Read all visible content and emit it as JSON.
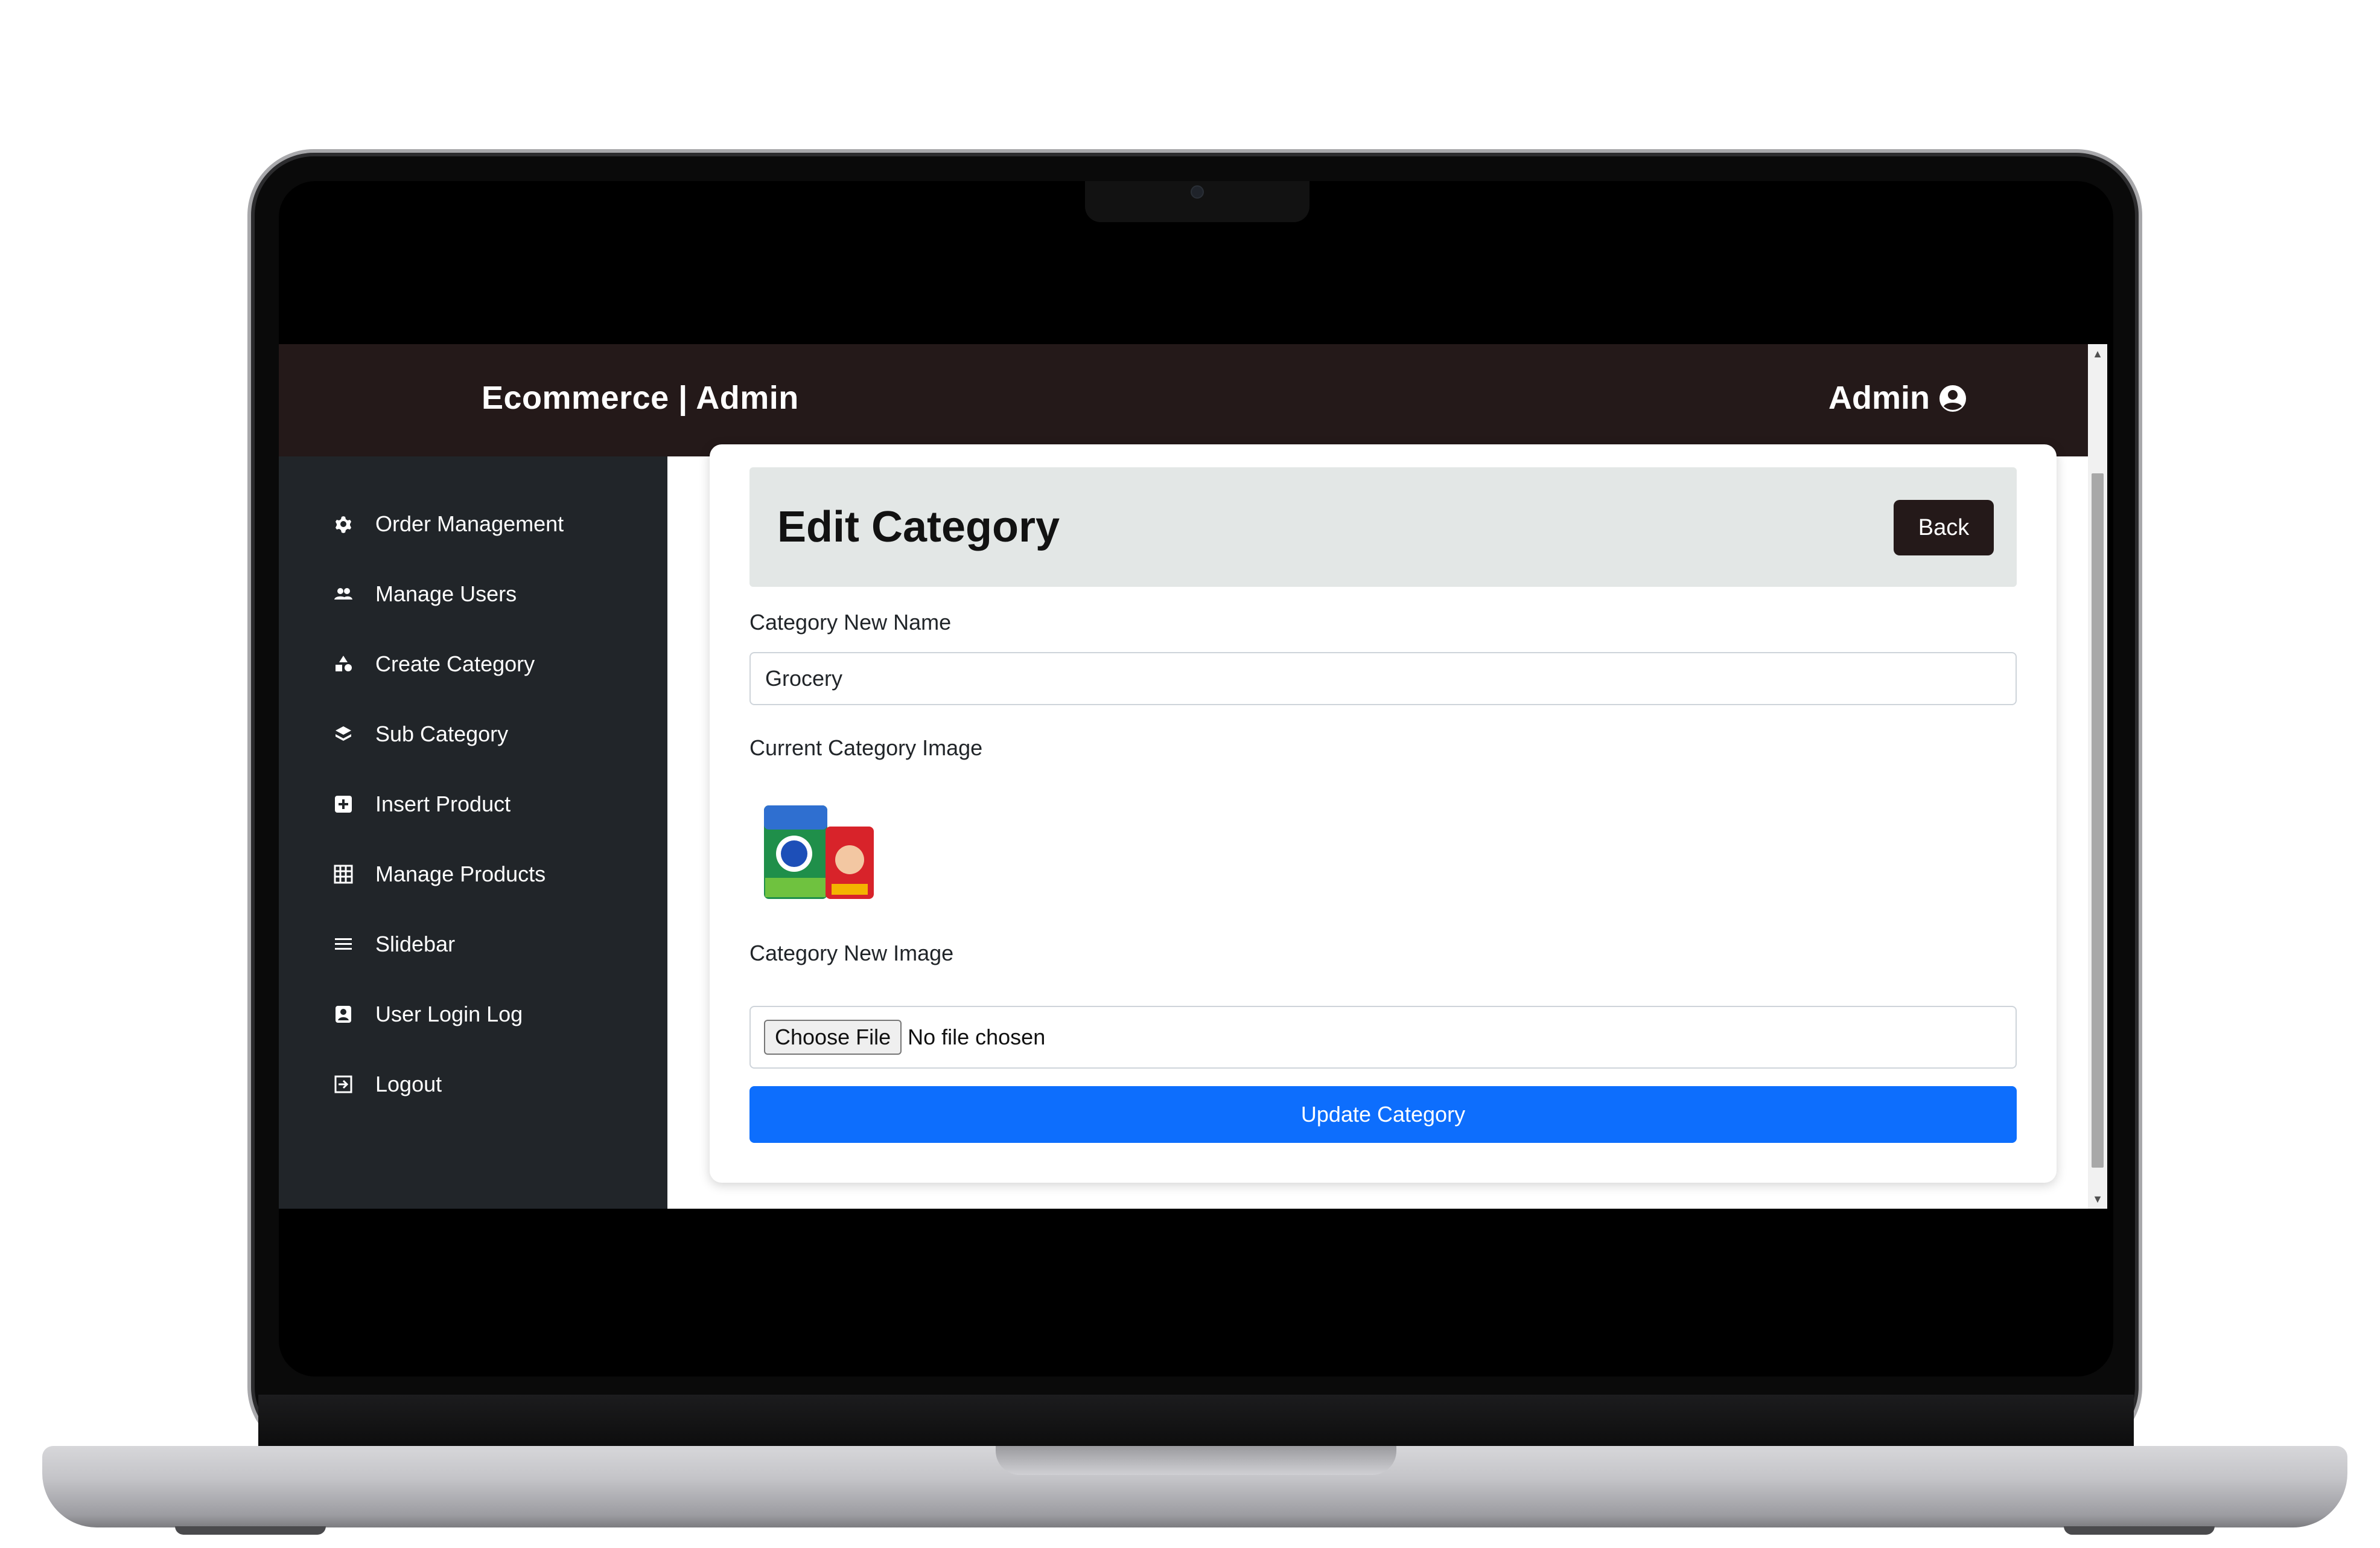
{
  "header": {
    "brand": "Ecommerce | Admin",
    "user_label": "Admin",
    "user_icon": "user-circle-icon"
  },
  "sidebar": {
    "items": [
      {
        "label": "Order Management",
        "icon": "gear-icon"
      },
      {
        "label": "Manage Users",
        "icon": "users-icon"
      },
      {
        "label": "Create Category",
        "icon": "shapes-icon"
      },
      {
        "label": "Sub Category",
        "icon": "layers-icon"
      },
      {
        "label": "Insert Product",
        "icon": "plus-square-icon"
      },
      {
        "label": "Manage Products",
        "icon": "table-icon"
      },
      {
        "label": "Slidebar",
        "icon": "bars-icon"
      },
      {
        "label": "User Login Log",
        "icon": "id-badge-icon"
      },
      {
        "label": "Logout",
        "icon": "sign-out-icon"
      }
    ]
  },
  "form": {
    "title": "Edit Category",
    "back_label": "Back",
    "name_label": "Category New Name",
    "name_value": "Grocery",
    "current_image_label": "Current Category Image",
    "new_image_label": "Category New Image",
    "choose_file_label": "Choose File",
    "no_file_text": "No file chosen",
    "submit_label": "Update Category"
  },
  "colors": {
    "topbar": "#241919",
    "sidebar": "#212529",
    "primary": "#0d6efd",
    "header_panel": "#e3e7e6"
  }
}
